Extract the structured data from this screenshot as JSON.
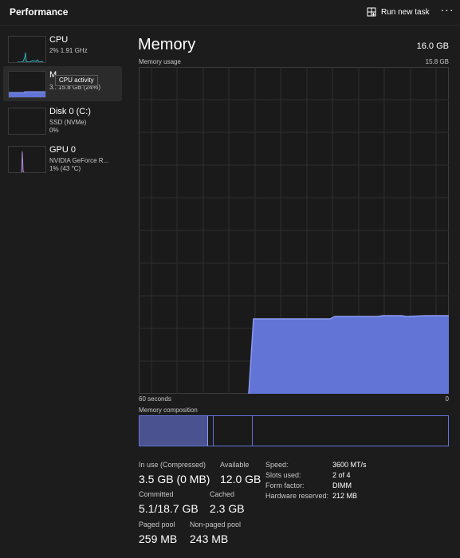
{
  "header": {
    "title": "Performance",
    "run_new_task_label": "Run new task",
    "more_icon": "ellipsis-icon"
  },
  "sidebar": {
    "items": [
      {
        "name": "CPU",
        "line1": "2%  1.91 GHz",
        "line2": "",
        "selected": false
      },
      {
        "name": "M",
        "line1": "3.. 15.8 GB (24%)",
        "line2": "",
        "selected": true
      },
      {
        "name": "Disk 0 (C:)",
        "line1": "SSD (NVMe)",
        "line2": "0%",
        "selected": false
      },
      {
        "name": "GPU 0",
        "line1": "NVIDIA GeForce R...",
        "line2": "1%  (43 °C)",
        "selected": false
      }
    ],
    "tooltip": "CPU activity"
  },
  "main": {
    "title": "Memory",
    "total": "16.0 GB",
    "usage_label": "Memory usage",
    "usage_max": "15.8 GB",
    "axis_left": "60 seconds",
    "axis_right": "0",
    "composition_label": "Memory composition"
  },
  "colors": {
    "accent": "#7b8ee8",
    "fill": "#6274d6",
    "grid": "#2e2e2e",
    "background": "#1c1c1c"
  },
  "stats": [
    {
      "label": "In use (Compressed)",
      "value": "3.5 GB (0 MB)"
    },
    {
      "label": "Available",
      "value": "12.0 GB"
    },
    {
      "label": "Committed",
      "value": "5.1/18.7 GB"
    },
    {
      "label": "Cached",
      "value": "2.3 GB"
    },
    {
      "label": "Paged pool",
      "value": "259 MB"
    },
    {
      "label": "Non-paged pool",
      "value": "243 MB"
    }
  ],
  "specs": [
    {
      "label": "Speed:",
      "value": "3600 MT/s"
    },
    {
      "label": "Slots used:",
      "value": "2 of 4"
    },
    {
      "label": "Form factor:",
      "value": "DIMM"
    },
    {
      "label": "Hardware reserved:",
      "value": "212 MB"
    }
  ]
}
